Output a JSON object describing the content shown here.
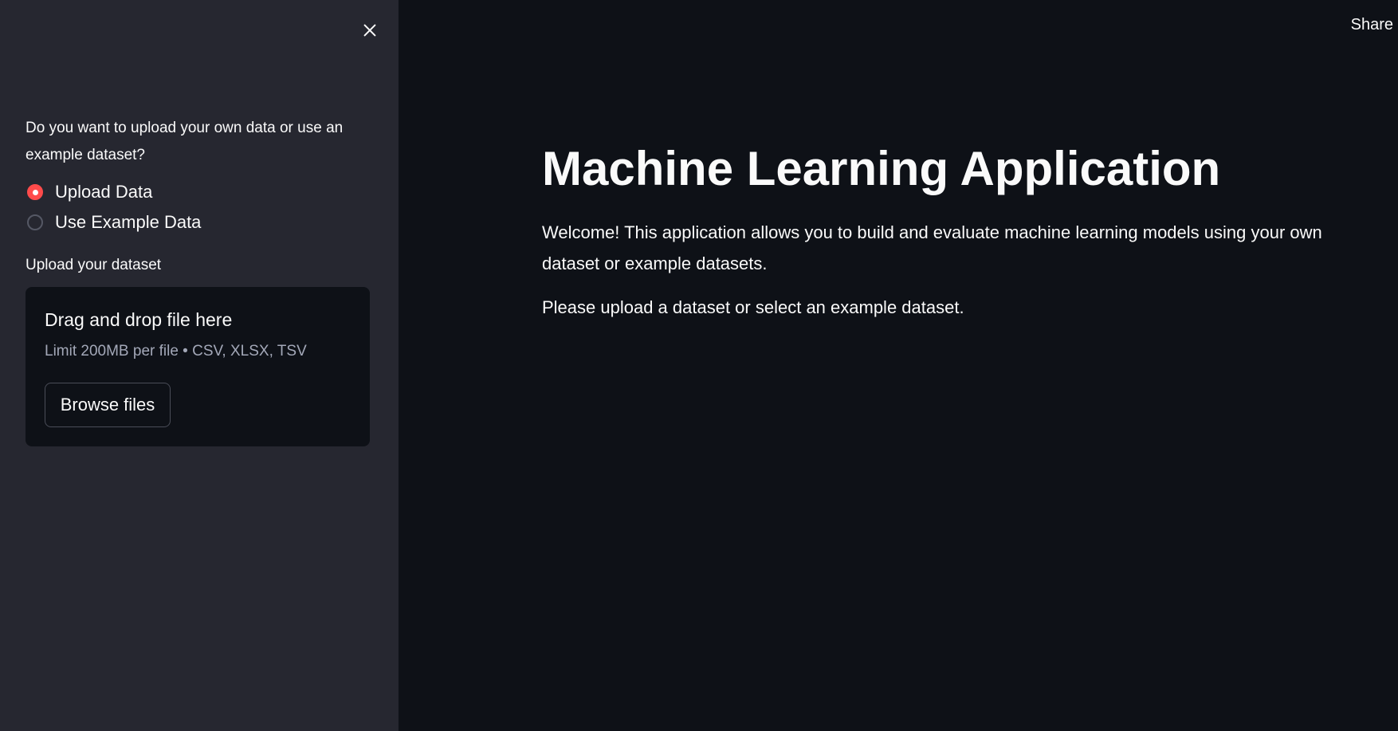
{
  "sidebar": {
    "close_icon": "close-icon",
    "question": "Do you want to upload your own data or use an example dataset?",
    "radio_options": [
      {
        "label": "Upload Data",
        "selected": true
      },
      {
        "label": "Use Example Data",
        "selected": false
      }
    ],
    "upload_label": "Upload your dataset",
    "dropzone": {
      "title": "Drag and drop file here",
      "limit": "Limit 200MB per file • CSV, XLSX, TSV",
      "browse_label": "Browse files"
    }
  },
  "header": {
    "share_label": "Share"
  },
  "main": {
    "title": "Machine Learning Application",
    "welcome": "Welcome! This application allows you to build and evaluate machine learning models using your own dataset or example datasets.",
    "instruction": "Please upload a dataset or select an example dataset."
  },
  "colors": {
    "sidebar_bg": "#262730",
    "main_bg": "#0e1117",
    "accent": "#ff4b4b",
    "text": "#fafafa",
    "muted_text": "#a3a8b8"
  }
}
